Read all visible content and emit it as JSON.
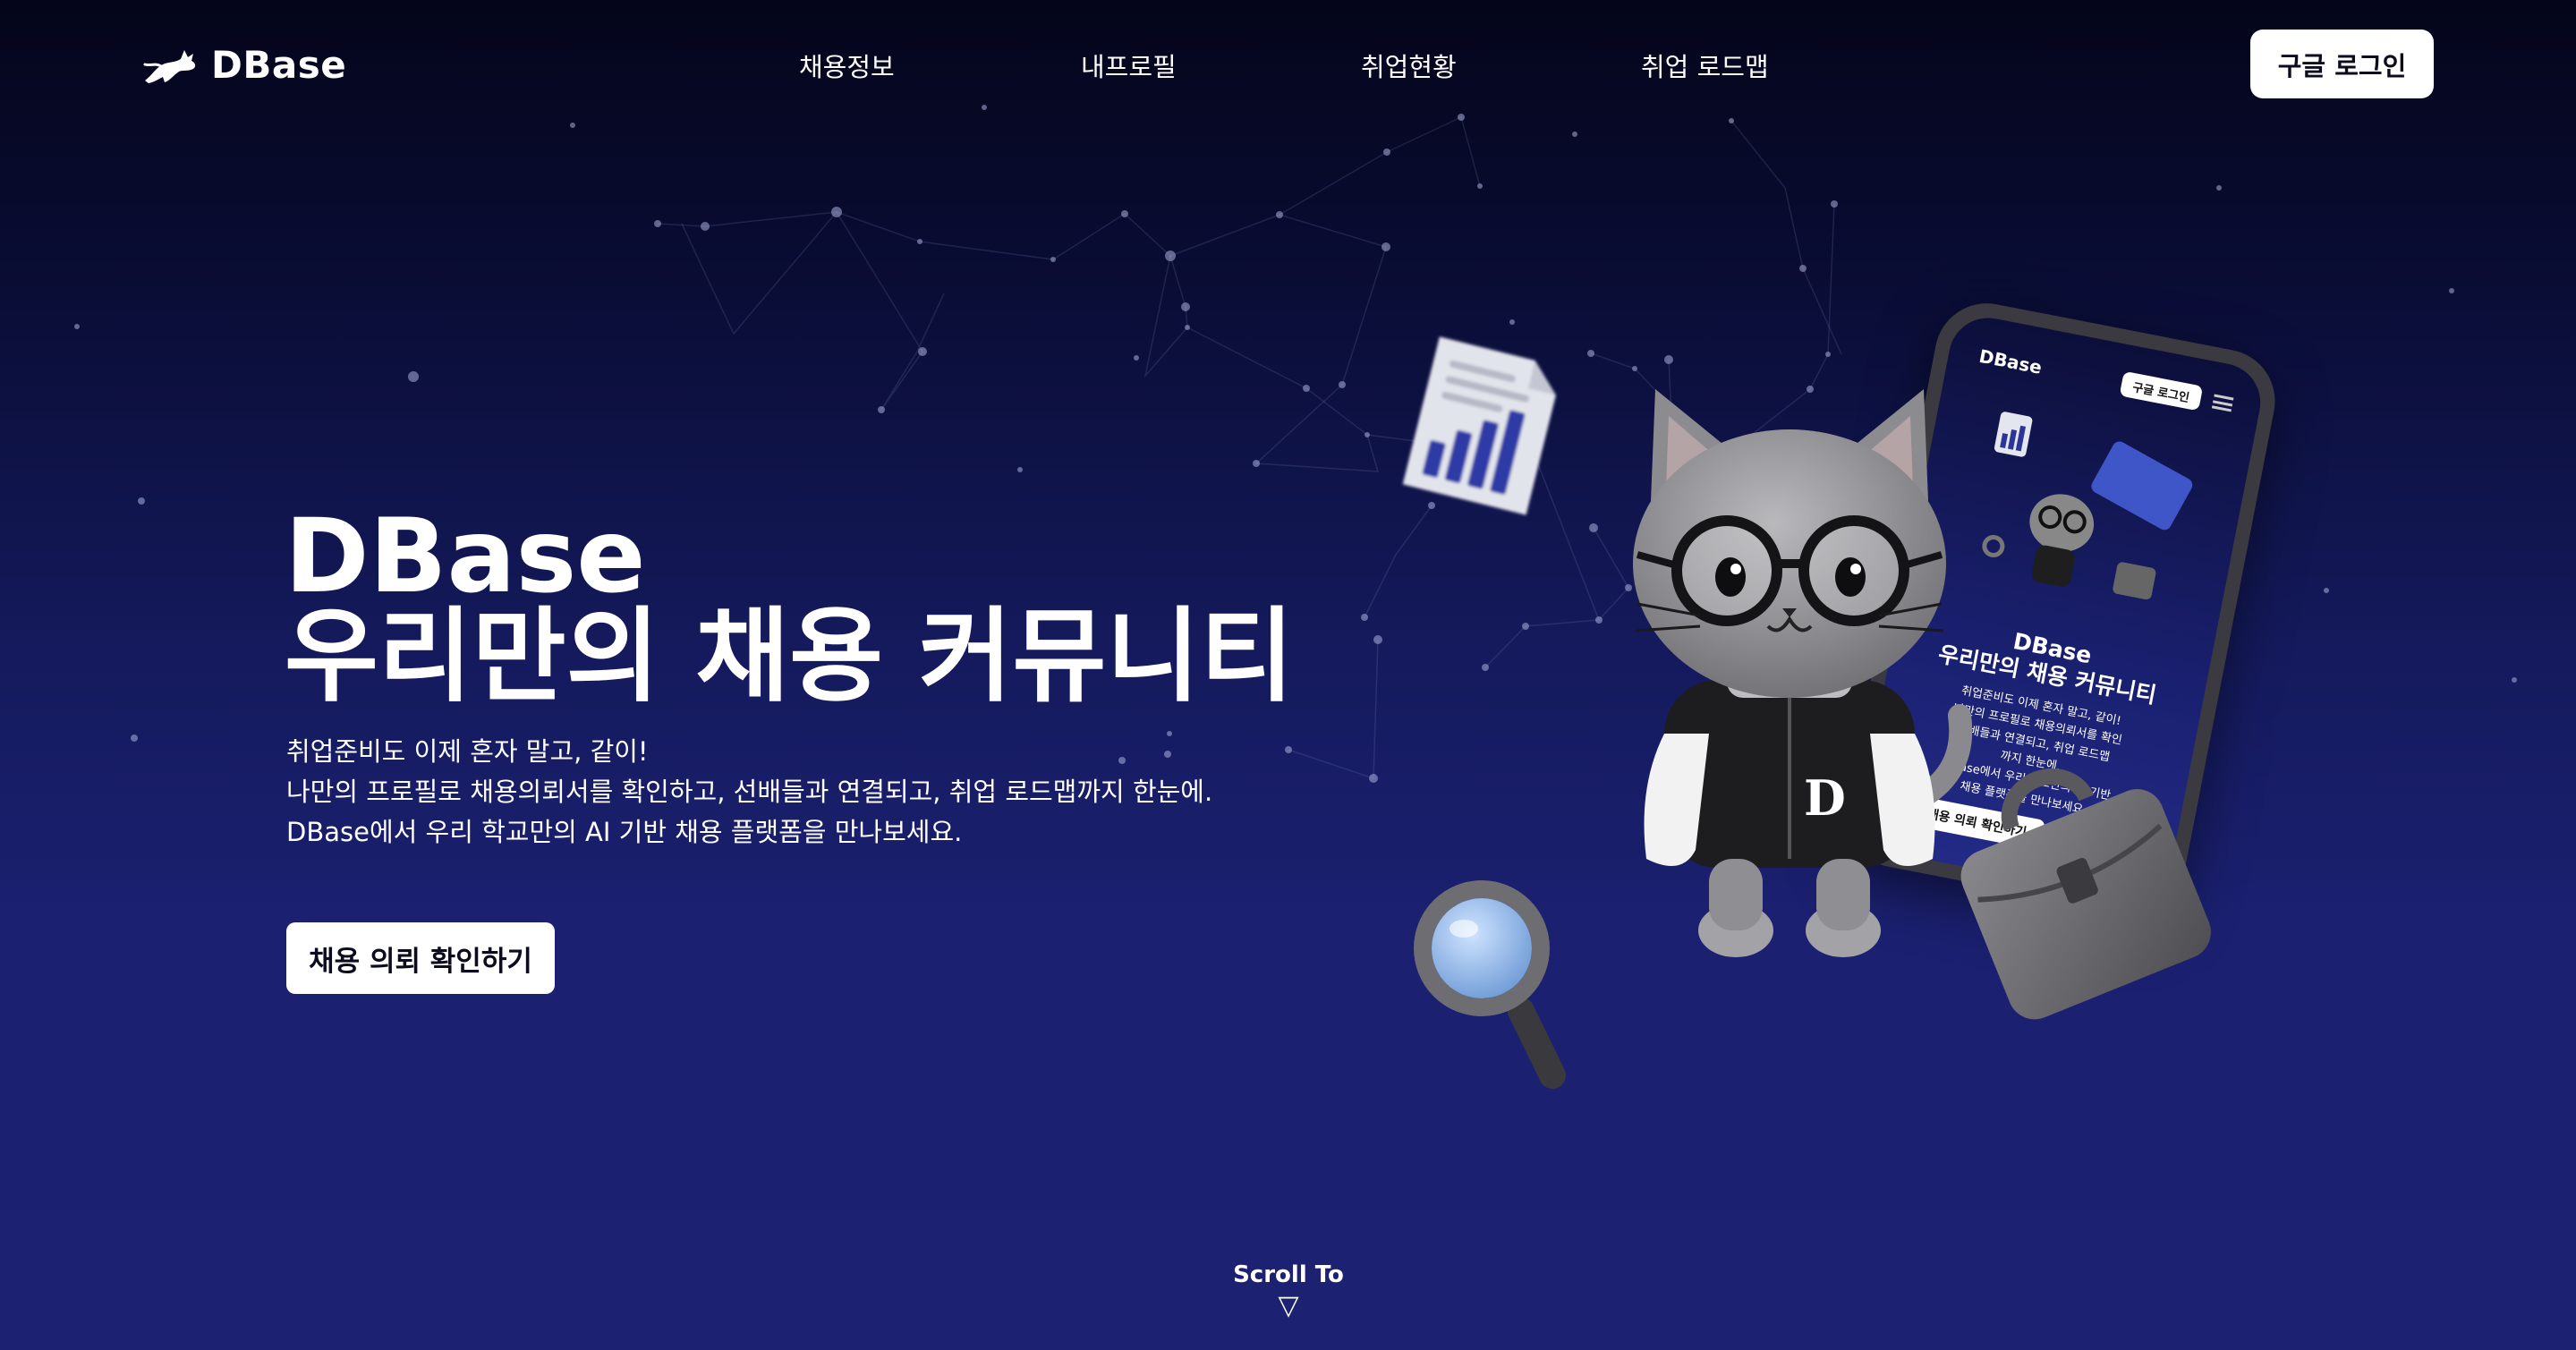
{
  "brand": {
    "name": "DBase"
  },
  "nav": {
    "items": [
      {
        "label": "채용정보"
      },
      {
        "label": "내프로필"
      },
      {
        "label": "취업현황"
      },
      {
        "label": "취업 로드맵"
      }
    ],
    "login_label": "구글 로그인"
  },
  "hero": {
    "title_line1": "DBase",
    "title_line2": "우리만의 채용 커뮤니티",
    "sub_line1": "취업준비도 이제 혼자 말고, 같이!",
    "sub_line2": "나만의 프로필로 채용의뢰서를 확인하고, 선배들과 연결되고, 취업 로드맵까지 한눈에.",
    "sub_line3": "DBase에서 우리 학교만의 AI 기반 채용 플랫폼을 만나보세요.",
    "cta_label": "채용 의뢰 확인하기"
  },
  "scroll": {
    "label": "Scroll To",
    "arrow": "▽"
  },
  "phone_mockup": {
    "logo": "DBase",
    "login_label": "구글 로그인",
    "title_line1": "DBase",
    "title_line2": "우리만의 채용 커뮤니티",
    "sub_lines": [
      "취업준비도 이제 혼자 말고, 같이!",
      "나만의 프로필로 채용의뢰서를 확인",
      "선배들과 연결되고, 취업 로드맵",
      "까지 한눈에.",
      "DBase에서 우리 학교만의 AI 기반",
      "채용 플랫폼을 만나보세요."
    ],
    "cta_label": "채용 의뢰 확인하기"
  },
  "mascot": {
    "jersey_letter": "D"
  },
  "icons": {
    "logo": "leaping-cat-icon",
    "document": "document-chart-icon",
    "magnifier": "magnifying-glass-icon",
    "briefcase": "briefcase-icon"
  },
  "colors": {
    "background_top": "#04051a",
    "background_bottom": "#1c2172",
    "button": "#ffffff"
  }
}
